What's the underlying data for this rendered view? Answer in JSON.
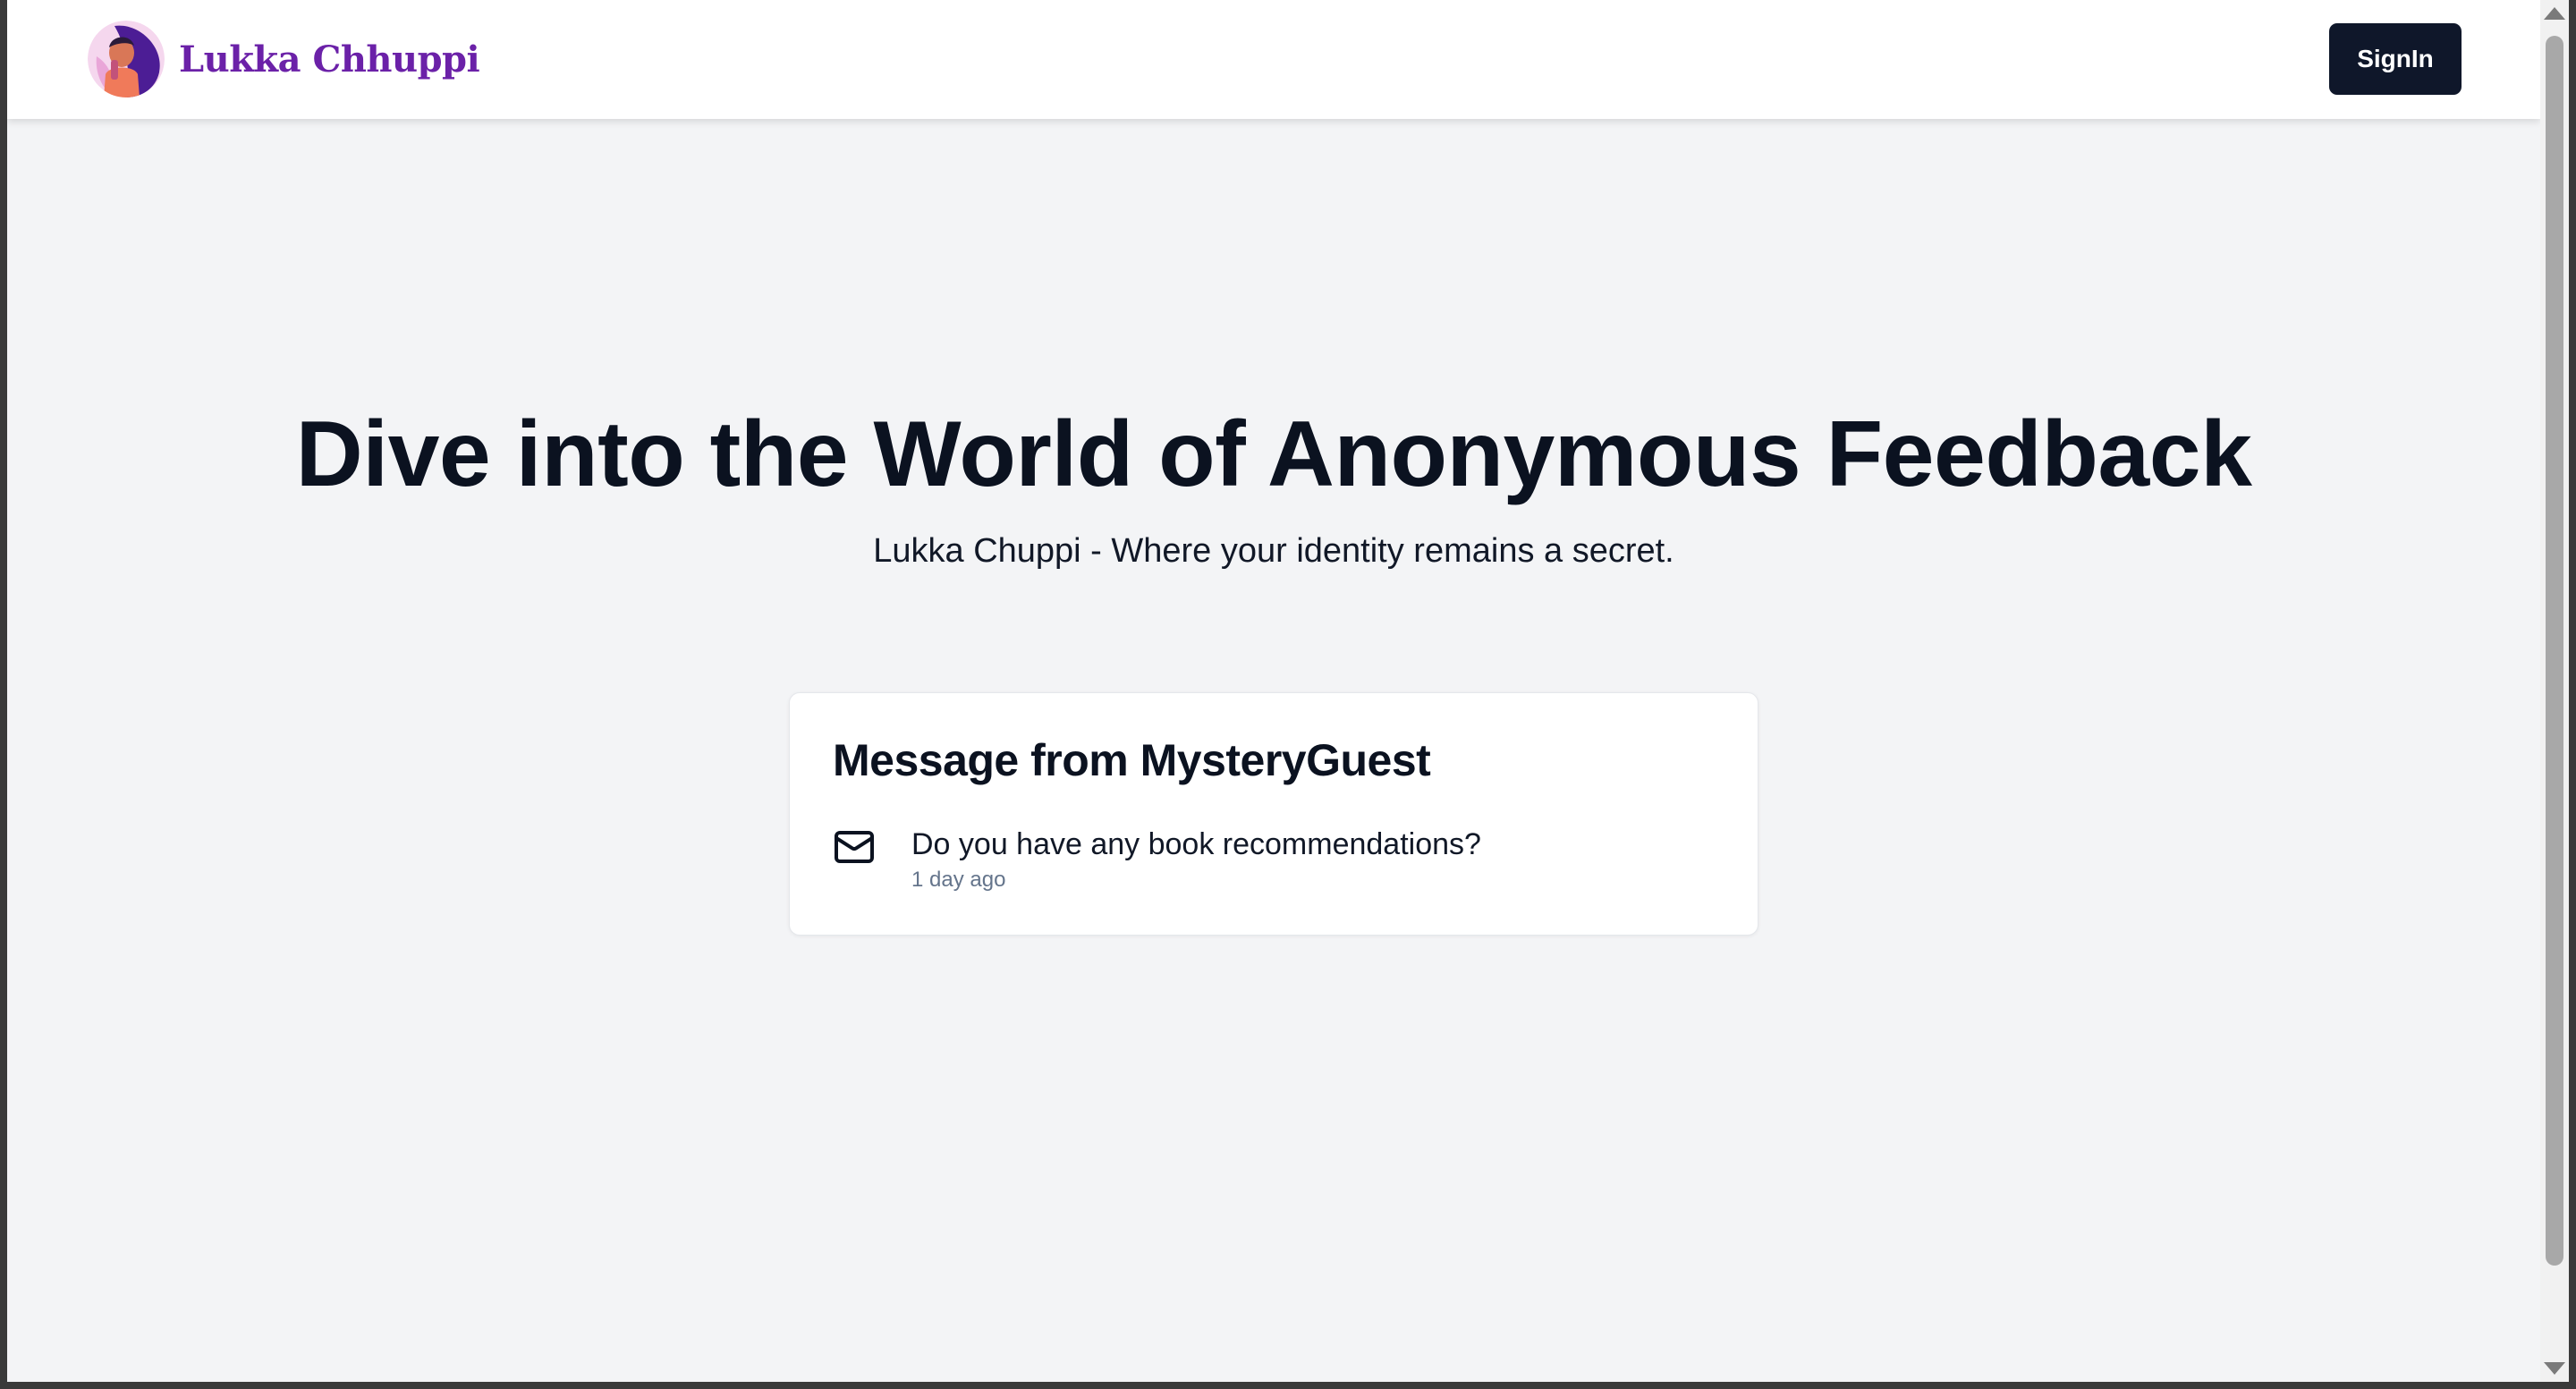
{
  "header": {
    "brand_name": "Lukka Chhuppi",
    "signin_label": "SignIn"
  },
  "hero": {
    "title": "Dive into the World of Anonymous Feedback",
    "subtitle": "Lukka Chuppi - Where your identity remains a secret."
  },
  "message_card": {
    "title": "Message from MysteryGuest",
    "icon": "mail-icon",
    "text": "Do you have any book recommendations?",
    "time": "1 day ago"
  },
  "colors": {
    "brand": "#6b21a8",
    "button_bg": "#0f172a",
    "page_bg": "#f3f4f6",
    "muted_text": "#64748b"
  }
}
